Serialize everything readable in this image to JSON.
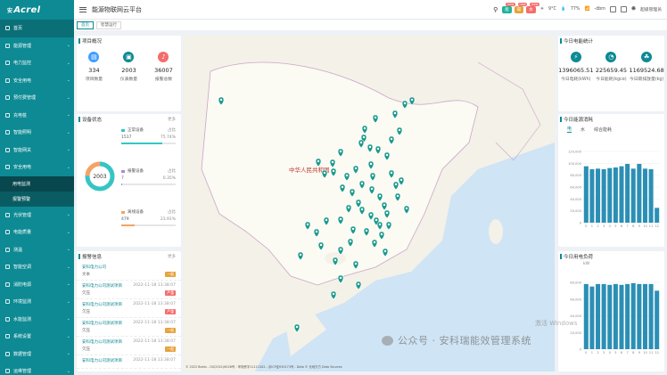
{
  "brand": {
    "logo": "Acrel",
    "logo_prefix": "安"
  },
  "header": {
    "title": "能源物联网云平台",
    "weather": "9°C",
    "humidity": "77%",
    "signal": "-dbm",
    "user": "超级管理员",
    "badges": [
      {
        "label": "能",
        "color": "#1fb39b"
      },
      {
        "label": "碳",
        "color": "#e6a23c"
      },
      {
        "label": "水",
        "color": "#f56c6c"
      }
    ],
    "badge_new": "new"
  },
  "tabs": [
    {
      "label": "首页",
      "active": true
    },
    {
      "label": "智慧运行",
      "active": false
    }
  ],
  "sidebar": {
    "items": [
      {
        "label": "首页",
        "active": true
      },
      {
        "label": "能源管理"
      },
      {
        "label": "电力监控"
      },
      {
        "label": "安全用电"
      },
      {
        "label": "预付费管理"
      },
      {
        "label": "充电桩"
      },
      {
        "label": "智能照明"
      },
      {
        "label": "智能网关"
      },
      {
        "label": "安全用电",
        "expanded": true
      },
      {
        "label": "用电监测",
        "sub": true,
        "active": true
      },
      {
        "label": "报警预警",
        "sub": true
      },
      {
        "label": "光伏管理"
      },
      {
        "label": "电能质量"
      },
      {
        "label": "测温"
      },
      {
        "label": "智能空调"
      },
      {
        "label": "消防电源"
      },
      {
        "label": "环境监测"
      },
      {
        "label": "水能监测"
      },
      {
        "label": "系统设置"
      },
      {
        "label": "数据管理"
      },
      {
        "label": "运维管理"
      }
    ]
  },
  "project_overview": {
    "title": "项目概况",
    "items": [
      {
        "value": "334",
        "label": "项目数量",
        "color": "#409eff",
        "icon": "building-icon"
      },
      {
        "value": "2003",
        "label": "仪表数量",
        "color": "#0d8a93",
        "icon": "meter-icon"
      },
      {
        "value": "36007",
        "label": "报警总数",
        "color": "#f56c6c",
        "icon": "alarm-icon"
      }
    ]
  },
  "device_status": {
    "title": "设备状态",
    "more": "更多",
    "total": "2003",
    "rows": [
      {
        "name": "正常设备",
        "count": "1517",
        "pct": "75.74%",
        "color": "#36c5c5",
        "frac": 0.7574
      },
      {
        "name": "报警设备",
        "count": "7",
        "pct": "0.35%",
        "color": "#a38be0",
        "frac": 0.0035
      },
      {
        "name": "离线设备",
        "count": "479",
        "pct": "23.91%",
        "color": "#f5a361",
        "frac": 0.2391
      }
    ],
    "col1": "台",
    "col2": "占比"
  },
  "alarms": {
    "title": "报警信息",
    "more": "更多",
    "items": [
      {
        "name": "安科电力公司",
        "time": "",
        "level": "文本",
        "tag": "一般",
        "tagc": "#e6a23c"
      },
      {
        "name": "安科电力公司测试项目",
        "time": "2022-11-18 13:38:07",
        "level": "欠压",
        "tag": "严重",
        "tagc": "#f56c6c"
      },
      {
        "name": "安科电力公司测试项目",
        "time": "2022-11-18 13:38:07",
        "level": "欠压",
        "tag": "严重",
        "tagc": "#f56c6c"
      },
      {
        "name": "安科电力公司测试项目",
        "time": "2022-11-18 13:38:07",
        "level": "欠压",
        "tag": "一般",
        "tagc": "#e6a23c"
      },
      {
        "name": "安科电力公司测试项目",
        "time": "2022-11-18 13:38:07",
        "level": "欠压",
        "tag": "一般",
        "tagc": "#e6a23c"
      },
      {
        "name": "安科电力公司测试项目",
        "time": "2022-11-18 13:38:07",
        "level": "",
        "tag": "",
        "tagc": ""
      }
    ]
  },
  "energy_stats": {
    "title": "今日电能统计",
    "items": [
      {
        "value": "1396065.51",
        "label": "今日电耗(kWh)",
        "icon": "lightning-icon"
      },
      {
        "value": "225659.45",
        "label": "今日能耗(kgce)",
        "icon": "gauge-icon"
      },
      {
        "value": "1169524.68",
        "label": "今日碳排放量(kg)",
        "icon": "leaf-icon"
      }
    ]
  },
  "map": {
    "label": "中华人民共和国",
    "attribution": "© 2022 Baidu - GS(2021)6026号 - 甲测资字11111342 - 京ICP证030173号 - Data © 长地万方 Data Sources"
  },
  "watermark": "公众号 · 安科瑞能效管理系统",
  "win_note": "激活 Windows",
  "chart_data": [
    {
      "type": "bar",
      "title": "今日能源消耗",
      "tabs": [
        "电",
        "水",
        "综合能耗"
      ],
      "categories": [
        "0",
        "1",
        "2",
        "3",
        "4",
        "5",
        "6",
        "7",
        "8",
        "9",
        "10",
        "11",
        "12"
      ],
      "values": [
        95000,
        90000,
        91000,
        90000,
        92000,
        93000,
        95000,
        99000,
        91000,
        99000,
        91000,
        90000,
        25000
      ],
      "ylim": [
        0,
        120000
      ],
      "ticks": [
        0,
        20000,
        40000,
        60000,
        80000,
        100000,
        120000
      ]
    },
    {
      "type": "bar",
      "title": "今日用电负荷",
      "unit": "kW",
      "categories": [
        "0",
        "1",
        "2",
        "3",
        "4",
        "5",
        "6",
        "7",
        "8",
        "9",
        "10",
        "11",
        "12"
      ],
      "values": [
        78000,
        75000,
        78000,
        78000,
        77000,
        78000,
        77000,
        78000,
        79000,
        78000,
        78000,
        78000,
        70000
      ],
      "ylim": [
        0,
        80000
      ],
      "ticks": [
        0,
        20000,
        40000,
        60000,
        80000
      ]
    }
  ]
}
